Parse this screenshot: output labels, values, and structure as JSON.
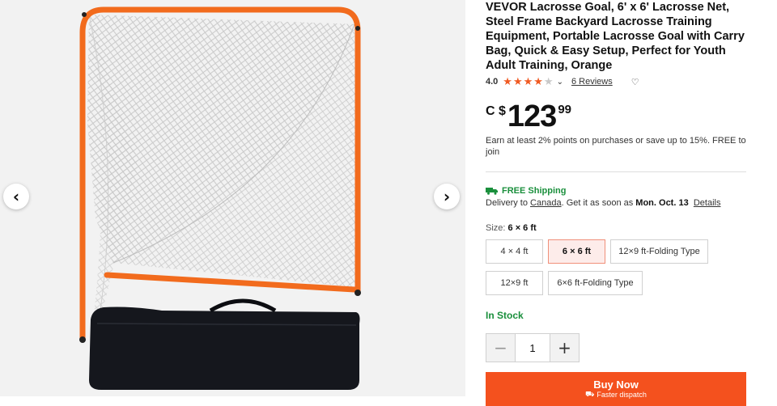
{
  "gallery": {
    "prev_icon": "‹",
    "next_icon": "›"
  },
  "product": {
    "title": "VEVOR Lacrosse Goal, 6' x 6' Lacrosse Net, Steel Frame Backyard Lacrosse Training Equipment, Portable Lacrosse Goal with Carry Bag, Quick & Easy Setup, Perfect for Youth Adult Training, Orange",
    "rating": "4.0",
    "rating_value": 4.0,
    "rating_max": 5,
    "reviews_link": "6 Reviews",
    "price": {
      "currency": "C $",
      "main": "123",
      "cents": "99"
    },
    "points_text": "Earn at least 2% points on purchases or save up to 15%.  FREE to join",
    "shipping": {
      "label": "FREE Shipping",
      "delivery_prefix": "Delivery to ",
      "country": "Canada",
      "get_it": ".  Get it as soon as ",
      "date": "Mon. Oct. 13",
      "details_link": "Details"
    },
    "size": {
      "label": "Size: ",
      "selected": "6 × 6 ft",
      "options": [
        "4 × 4 ft",
        "6 × 6 ft",
        "12×9 ft-Folding Type",
        "12×9 ft",
        "6×6 ft-Folding Type"
      ]
    },
    "stock_status": "In Stock",
    "quantity": {
      "minus": "−",
      "value": "1",
      "plus": "+"
    },
    "buy": {
      "label": "Buy Now",
      "sub": "Faster dispatch"
    }
  },
  "colors": {
    "accent": "#f4511e",
    "star": "#f05a22",
    "stock_green": "#1a8f3c",
    "frame_orange": "#f26b1d"
  },
  "icons": [
    "chevron-left-icon",
    "chevron-right-icon",
    "star-icon",
    "chevron-down-icon",
    "heart-icon",
    "truck-icon",
    "minus-icon",
    "plus-icon"
  ]
}
